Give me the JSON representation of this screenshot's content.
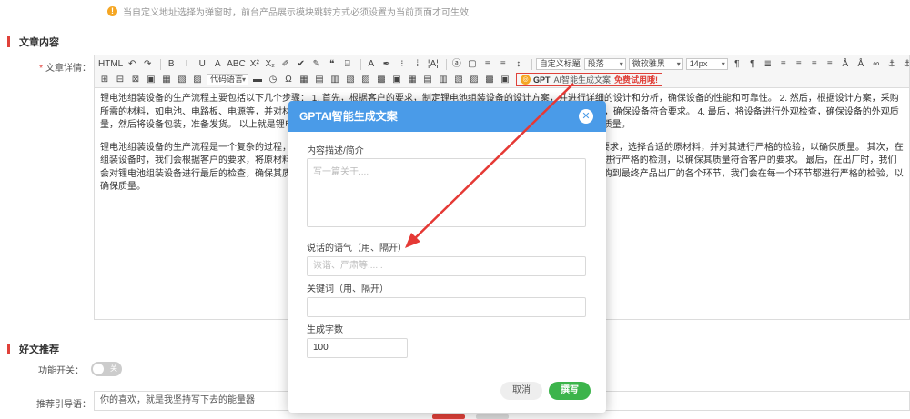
{
  "notice": {
    "text": "当自定义地址选择为弹窗时，前台产品展示模块跳转方式必须设置为当前页面才可生效"
  },
  "sections": {
    "article_content": "文章内容",
    "good_recommend": "好文推荐"
  },
  "form": {
    "article_detail_label": "文章详情：",
    "feature_switch_label": "功能开关：",
    "recommend_guide_label": "推荐引导语：",
    "switch_state": "关",
    "recommend_guide_value": "你的喜欢，就是我坚持写下去的能量器"
  },
  "toolbar": {
    "row1": [
      "HTML",
      "↶",
      "↷",
      "B",
      "I",
      "U",
      "A",
      "ABC",
      "X²",
      "X₂",
      "✐",
      "✔",
      "✎",
      "❝",
      "⌸",
      "A",
      "✒",
      "⁝",
      "⁞",
      "¦A¦",
      "ⓐ",
      "▢",
      "≡",
      "≡",
      "↕"
    ],
    "selects": {
      "title": "自定义标题",
      "paragraph": "段落",
      "font": "微软雅黑",
      "size": "14px"
    },
    "row1_right": [
      "¶",
      "¶",
      "≣",
      "≡",
      "≡",
      "≡",
      "≡",
      "Å",
      "Å",
      "∞",
      "⚓",
      "⚓"
    ],
    "row2": [
      "⊞",
      "⊟",
      "⊠",
      "▣",
      "▦",
      "▧",
      "▨"
    ],
    "code_lang": "代码语言",
    "row2_icons": [
      "▬",
      "◷",
      "Ω",
      "▦",
      "▤",
      "▥",
      "▧",
      "▨",
      "▩",
      "▣",
      "▦",
      "▤",
      "▥",
      "▧",
      "▨",
      "▩",
      "▣"
    ],
    "gpt": {
      "label": "GPT",
      "ai_text": "AI智能生成文案",
      "free_text": "免费试用哦!"
    }
  },
  "editor_content": {
    "p1": "锂电池组装设备的生产流程主要包括以下几个步骤： 1. 首先，根据客户的要求，制定锂电池组装设备的设计方案，并进行详细的设计和分析，确保设备的性能和可靠性。 2. 然后，根据设计方案，采购所需的材料，如电池、电路板、电源等，并对材料进行检查，确保材料的质量。 3. 按照设计方案，进行组装，并进行功能测试，确保设备符合要求。 4. 最后，将设备进行外观检查，确保设备的外观质量，然后将设备包装，准备发货。 以上就是锂电池组装设备的生产流程，在生产过程中，我们严格控制每一个环节，确保产品质量。",
    "p2": "锂电池组装设备的生产流程是一个复杂的过程，它包括设计、采购、组装、检测和包装等多个环节。首先，我们会根据客户的要求，选择合适的原材料，并对其进行严格的检验，以确保质量。 其次，在组装设备时，我们会根据客户的要求，将原材料组装成锂电池组装设备，并进行功能测试。 然后，在检测环节，我们会对设备进行严格的检测，以确保其质量符合客户的要求。 最后，在出厂时，我们会对锂电池组装设备进行最后的检查，确保其质量符合客户的要求。 总之，锂电池组装设备的生产流程是严谨的，从原材料采购到最终产品出厂的各个环节，我们会在每一个环节都进行严格的检验，以确保质量。"
  },
  "modal": {
    "title": "GPTAI智能生成文案",
    "desc_label": "内容描述/简介",
    "desc_placeholder": "写一篇关于....",
    "tone_label": "说话的语气（用、隔开）",
    "tone_placeholder": "诙谐、严肃等......",
    "keywords_label": "关键词（用、隔开）",
    "keywords_placeholder": "",
    "count_label": "生成字数",
    "count_value": "100",
    "cancel_label": "取消",
    "write_label": "撰写"
  },
  "colors": {
    "accent_red": "#e0413a",
    "modal_header": "#4a9be8",
    "write_button": "#3cb44b",
    "arrow": "#e53935"
  }
}
